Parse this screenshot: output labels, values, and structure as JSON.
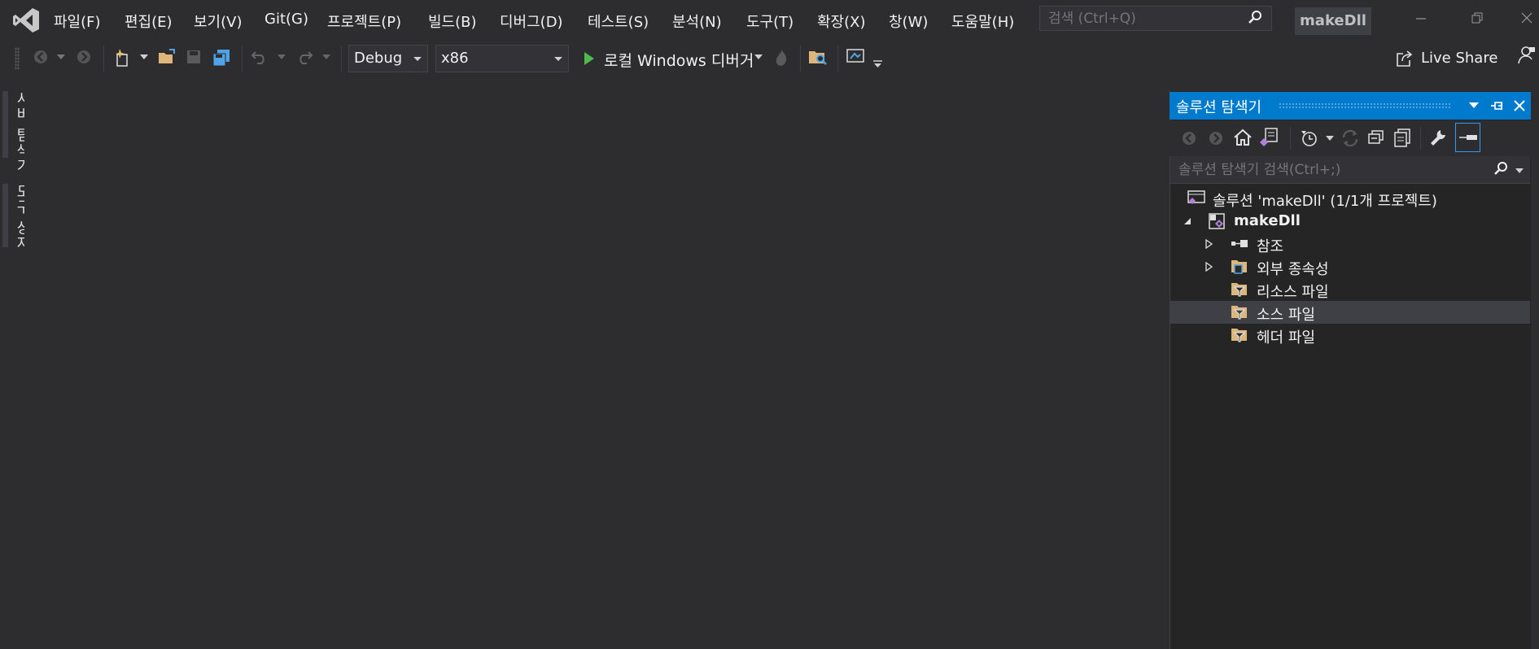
{
  "app": {
    "solution_badge": "makeDll"
  },
  "menu": [
    "파일(F)",
    "편집(E)",
    "보기(V)",
    "Git(G)",
    "프로젝트(P)",
    "빌드(B)",
    "디버그(D)",
    "테스트(S)",
    "분석(N)",
    "도구(T)",
    "확장(X)",
    "창(W)",
    "도움말(H)"
  ],
  "search": {
    "placeholder": "검색 (Ctrl+Q)"
  },
  "toolbar": {
    "configuration": "Debug",
    "platform": "x86",
    "debug_target": "로컬 Windows 디버거",
    "live_share": "Live Share"
  },
  "side_tabs": [
    "서버 탐색기",
    "도구 상자"
  ],
  "solution_explorer": {
    "title": "솔루션 탐색기",
    "search_placeholder": "솔루션 탐색기 검색(Ctrl+;)",
    "tree": {
      "solution": "솔루션 'makeDll' (1/1개 프로젝트)",
      "project": "makeDll",
      "items": [
        {
          "label": "참조",
          "expandable": true,
          "icon": "references-icon"
        },
        {
          "label": "외부 종속성",
          "expandable": true,
          "icon": "external-dependencies-icon"
        },
        {
          "label": "리소스 파일",
          "expandable": false,
          "icon": "folder-filter-icon"
        },
        {
          "label": "소스 파일",
          "expandable": false,
          "icon": "folder-filter-icon",
          "selected": true
        },
        {
          "label": "헤더 파일",
          "expandable": false,
          "icon": "folder-filter-icon"
        }
      ]
    }
  },
  "colors": {
    "accent": "#007acc",
    "background": "#2d2d30",
    "panel": "#252526"
  }
}
